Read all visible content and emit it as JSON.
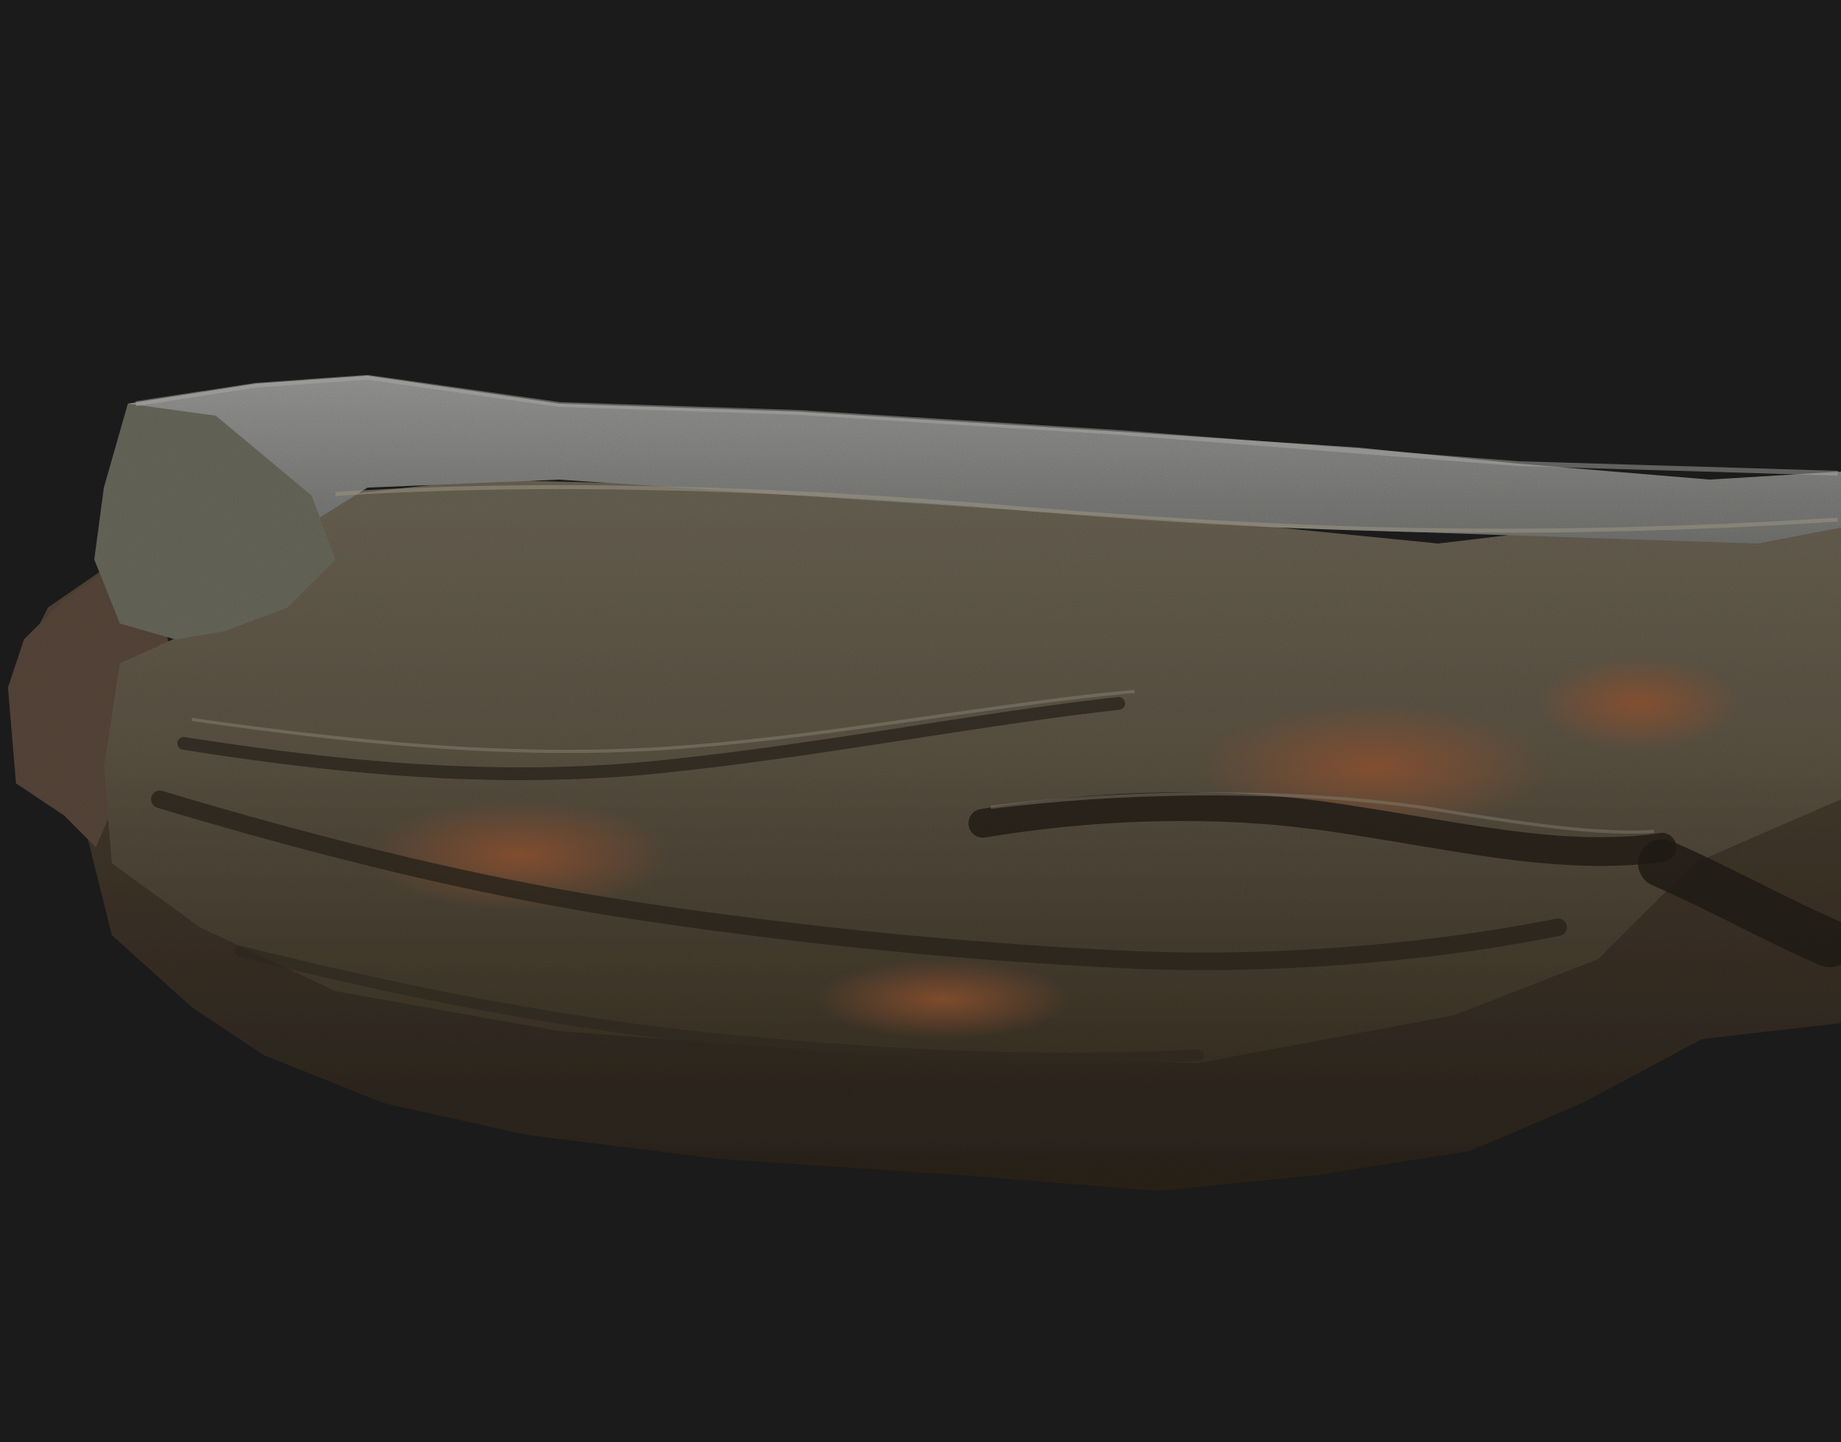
{
  "scene": {
    "subject": "rock",
    "background_color": "#1b1b1b",
    "colors": {
      "top_face_light": "#8c8d8b",
      "top_face_mid": "#6f706d",
      "front_face": "#625a4c",
      "rust": "#7a4a30",
      "shadow_crevice": "#2a241d",
      "underside": "#4a3f31"
    }
  }
}
